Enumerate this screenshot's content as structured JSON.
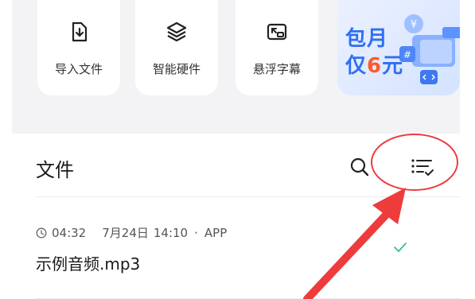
{
  "shortcuts": [
    {
      "label": "导入文件",
      "icon": "import-file-icon"
    },
    {
      "label": "智能硬件",
      "icon": "layers-icon"
    },
    {
      "label": "悬浮字幕",
      "icon": "floating-subtitle-icon"
    }
  ],
  "promo": {
    "line1": "包月",
    "line2_prefix": "仅",
    "line2_number": "6",
    "line2_suffix": "元"
  },
  "files_section": {
    "title": "文件"
  },
  "file_item": {
    "duration": "04:32",
    "date": "7月24日",
    "time": "14:10",
    "separator": "·",
    "source": "APP",
    "name": "示例音频.mp3"
  },
  "colors": {
    "accent": "#2f6ff3",
    "check": "#3fbf7f",
    "annotation": "#ee3b3b"
  }
}
